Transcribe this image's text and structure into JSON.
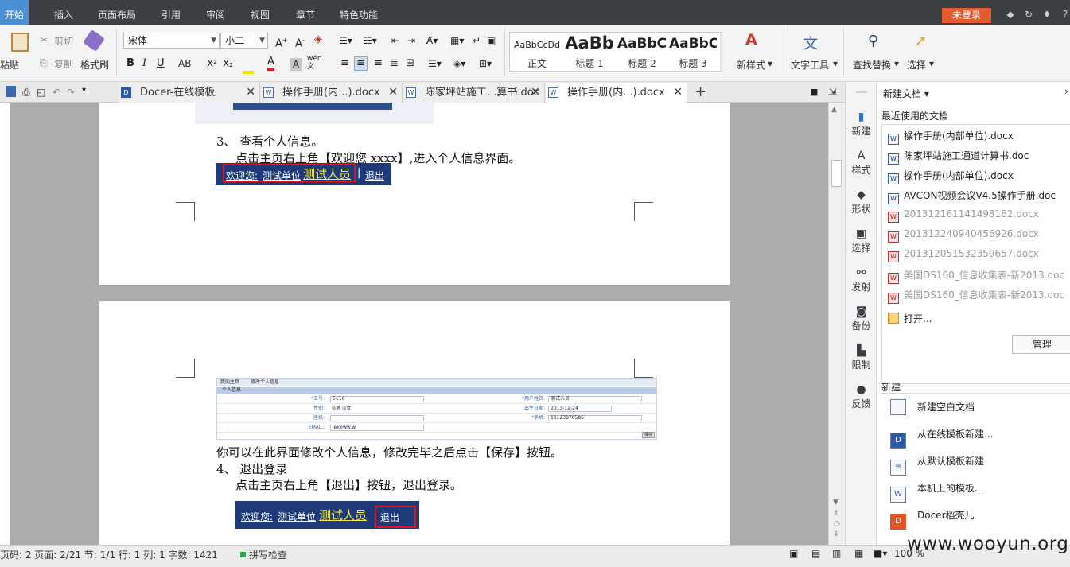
{
  "menubar": {
    "tabs": [
      "开始",
      "插入",
      "页面布局",
      "引用",
      "审阅",
      "视图",
      "章节",
      "特色功能"
    ],
    "login": "未登录"
  },
  "ribbon": {
    "paste": "粘贴",
    "cut": "剪切",
    "copy": "复制",
    "format_painter": "格式刷",
    "font_name": "宋体",
    "font_size": "小二",
    "styles": [
      {
        "preview": "AaBbCcDd",
        "label": "正文"
      },
      {
        "preview": "AaBb",
        "label": "标题 1"
      },
      {
        "preview": "AaBbC",
        "label": "标题 2"
      },
      {
        "preview": "AaBbC",
        "label": "标题 3"
      }
    ],
    "new_style": "新样式",
    "text_tools": "文字工具",
    "find_replace": "查找替换",
    "select": "选择"
  },
  "tabs": [
    {
      "title": "Docer-在线模板"
    },
    {
      "title": "操作手册(内...).docx"
    },
    {
      "title": "陈家坪站施工...算书.doc"
    },
    {
      "title": "操作手册(内...).docx"
    }
  ],
  "document": {
    "p1_step": "3、 查看个人信息。",
    "p1_body": "点击主页右上角【欢迎您 xxxx】,进入个人信息界面。",
    "welcome_prefix": "欢迎您:",
    "welcome_unit": "测试单位",
    "welcome_name": "测试人员",
    "logout": "退出",
    "form": {
      "tab_home": "我的主页",
      "tab_edit": "修改个人信息",
      "section": "个人信息",
      "rows": [
        {
          "l1": "*工号:",
          "v1": "5116",
          "l2": "*用户姓名:",
          "v2": "测试人员"
        },
        {
          "l1": "性别:",
          "v1": "◎男 ◎女",
          "l2": "出生日期:",
          "v2": "2013-12-24"
        },
        {
          "l1": "座机:",
          "v1": "",
          "l2": "*手机:",
          "v2": "13123870585"
        },
        {
          "l1": "EMAIL:",
          "v1": "lei@ww.w",
          "l2": "",
          "v2": ""
        }
      ],
      "save": "保存"
    },
    "p2_body": "你可以在此界面修改个人信息，修改完毕之后点击【保存】按钮。",
    "p2_step": "4、 退出登录",
    "p2_detail": "点击主页右上角【退出】按钮，退出登录。"
  },
  "sidebar": {
    "items": [
      "新建",
      "样式",
      "形状",
      "选择",
      "发射",
      "备份",
      "限制",
      "反馈"
    ]
  },
  "right_panel": {
    "header": "新建文档",
    "recent_title": "最近使用的文档",
    "recent": [
      {
        "name": "操作手册(内部单位).docx",
        "grey": false
      },
      {
        "name": "陈家坪站施工通道计算书.doc",
        "grey": false
      },
      {
        "name": "操作手册(内部单位).docx",
        "grey": false
      },
      {
        "name": "AVCON视频会议V4.5操作手册.doc",
        "grey": false
      },
      {
        "name": "201312161141498162.docx",
        "grey": true
      },
      {
        "name": "201312240940456926.docx",
        "grey": true
      },
      {
        "name": "201312051532359657.docx",
        "grey": true
      },
      {
        "name": "美国DS160_信息收集表-新2013.doc",
        "grey": true
      },
      {
        "name": "美国DS160_信息收集表-新2013.doc",
        "grey": true
      }
    ],
    "open": "打开...",
    "manage": "管理",
    "new_title": "新建",
    "new_items": [
      "新建空白文档",
      "从在线模板新建...",
      "从默认模板新建",
      "本机上的模板...",
      "Docer稻壳儿"
    ]
  },
  "statusbar": {
    "text": "页码: 2   页面: 2/21   节: 1/1   行: 1   列: 1   字数: 1421",
    "spell": "拼写检查",
    "zoom": "100 %"
  },
  "watermark": "www.wooyun.org"
}
